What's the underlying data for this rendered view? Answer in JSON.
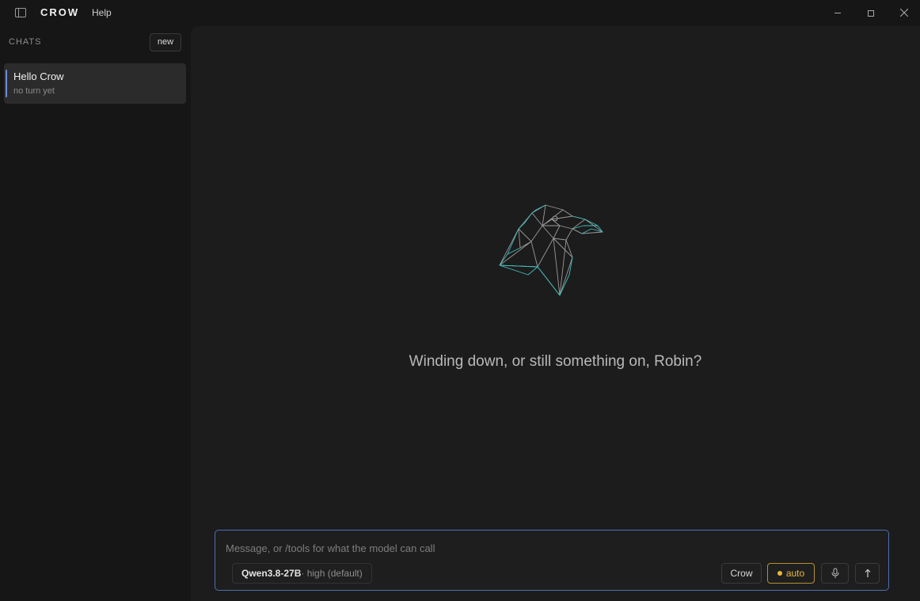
{
  "titlebar": {
    "brand": "CROW",
    "help_label": "Help"
  },
  "sidebar": {
    "heading": "CHATS",
    "new_label": "new",
    "chats": [
      {
        "title": "Hello Crow",
        "subtitle": "no turn yet",
        "active": true
      }
    ]
  },
  "main": {
    "greeting": "Winding down, or still something on, Robin?"
  },
  "composer": {
    "placeholder": "Message, or /tools for what the model can call",
    "value": "",
    "model_name": "Qwen3.8-27B",
    "model_detail": "· high (default)",
    "agent_label": "Crow",
    "mode_label": "auto",
    "mic_icon": "microphone-icon",
    "send_icon": "arrow-up-icon"
  },
  "colors": {
    "accent_blue": "#4b6fb3",
    "auto_yellow": "#e7b73c",
    "logo_teal": "#3fc1c0",
    "logo_grey": "#9a9a9a"
  }
}
